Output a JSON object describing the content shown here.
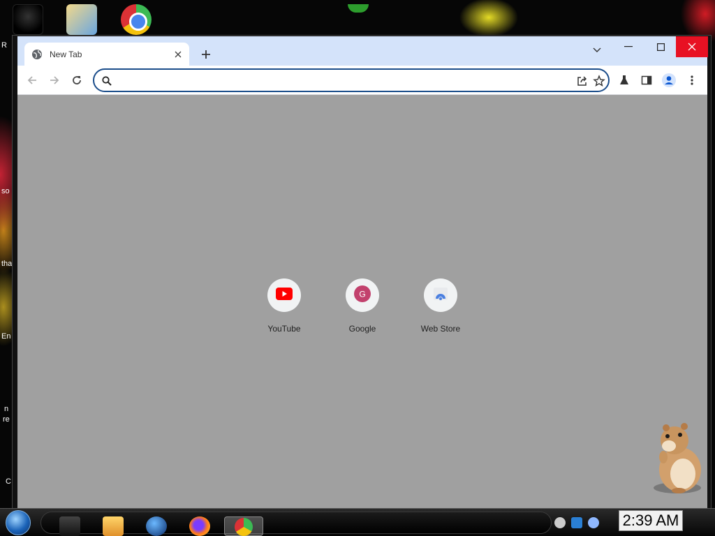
{
  "desktop": {
    "left_edge_fragments": [
      "R",
      "so",
      "tha",
      "En",
      "n",
      "re",
      "C"
    ]
  },
  "browser": {
    "tab": {
      "title": "New Tab",
      "favicon": "globe-icon"
    },
    "window_controls": [
      "tab-search",
      "minimize",
      "maximize",
      "close"
    ],
    "omnibox": {
      "value": "",
      "placeholder": ""
    },
    "toolbar_icons": [
      "back-icon",
      "forward-icon",
      "reload-icon",
      "share-icon",
      "star-icon",
      "labs-icon",
      "side-panel-icon",
      "profile-icon",
      "menu-icon"
    ],
    "shortcuts": [
      {
        "label": "YouTube",
        "icon": "youtube-icon"
      },
      {
        "label": "Google",
        "icon": "google-g-icon"
      },
      {
        "label": "Web Store",
        "icon": "web-store-icon"
      }
    ]
  },
  "taskbar": {
    "apps": [
      "explorer",
      "media-player",
      "globe",
      "firefox",
      "chrome"
    ],
    "active_app": "chrome",
    "clock": "2:39 AM"
  },
  "colors": {
    "titlebar": "#d4e3fa",
    "content_bg": "#a0a0a0",
    "close_red": "#e81123",
    "omnibox_border": "#1a4c8a"
  }
}
